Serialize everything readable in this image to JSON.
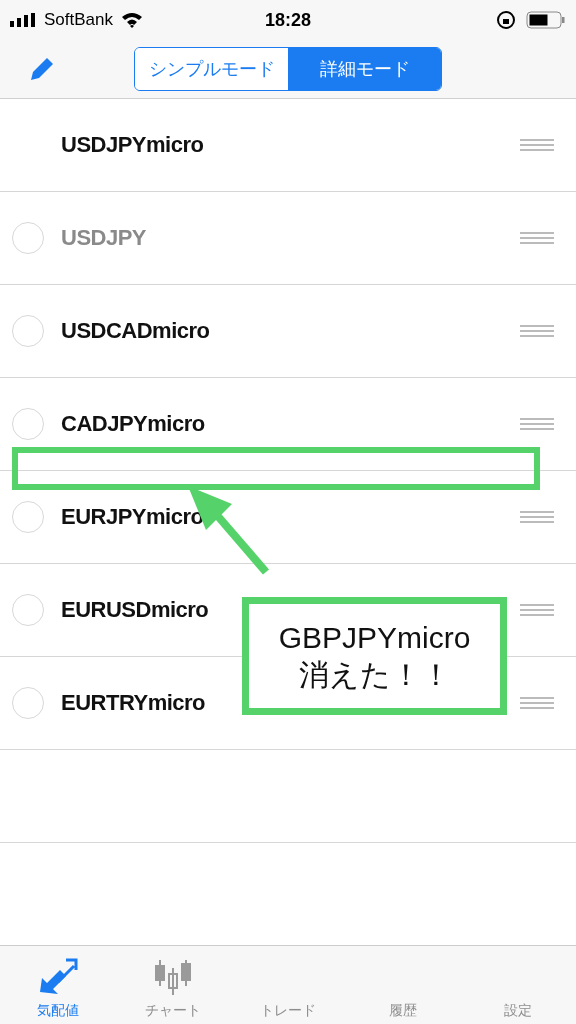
{
  "status_bar": {
    "carrier": "SoftBank",
    "time": "18:28"
  },
  "mode_switch": [
    {
      "label": "シンプルモード",
      "selected": false
    },
    {
      "label": "詳細モード",
      "selected": true
    }
  ],
  "symbols": [
    {
      "name": "USDJPYmicro",
      "kind": "fixed",
      "disabled": false
    },
    {
      "name": "USDJPY",
      "kind": "selectable",
      "disabled": true
    },
    {
      "name": "USDCADmicro",
      "kind": "selectable",
      "disabled": false
    },
    {
      "name": "CADJPYmicro",
      "kind": "selectable",
      "disabled": false
    },
    {
      "name": "EURJPYmicro",
      "kind": "selectable",
      "disabled": false
    },
    {
      "name": "EURUSDmicro",
      "kind": "selectable",
      "disabled": false
    },
    {
      "name": "EURTRYmicro",
      "kind": "selectable",
      "disabled": false
    }
  ],
  "annotation": {
    "lines": [
      "GBPJPYmicro",
      "消えた！！"
    ]
  },
  "tab_bar": [
    {
      "label": "気配値",
      "kind": "quotes",
      "selected": true
    },
    {
      "label": "チャート",
      "kind": "chart",
      "selected": false
    },
    {
      "label": "トレード",
      "selected": false
    },
    {
      "label": "履歴",
      "selected": false
    },
    {
      "label": "設定",
      "selected": false
    }
  ]
}
